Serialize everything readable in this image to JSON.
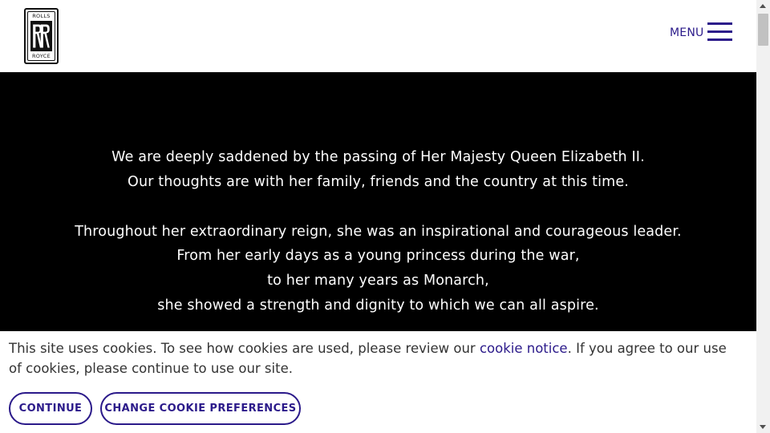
{
  "header": {
    "logo": {
      "top_text": "ROLLS",
      "monogram": "RR",
      "bottom_text": "ROYCE"
    },
    "menu_label": "MENU"
  },
  "tribute": {
    "lines": [
      "We are deeply saddened by the passing of Her Majesty Queen Elizabeth II.",
      "Our thoughts are with her family, friends and the country at this time.",
      "Throughout her extraordinary reign, she was an inspirational and courageous leader.",
      "From her early days as a young princess during the war,",
      "to her many years as Monarch,",
      "she showed a strength and dignity to which we can all aspire."
    ]
  },
  "cookie_banner": {
    "text_before_link": "This site uses cookies. To see how cookies are used, please review our ",
    "link_text": "cookie notice",
    "text_after_link": ". If you agree to our use of cookies, please continue to use our site.",
    "continue_label": "CONTINUE",
    "preferences_label": "CHANGE COOKIE PREFERENCES"
  },
  "colors": {
    "accent": "#2b1a8a",
    "tribute_background": "#000000",
    "page_background": "#ffffff"
  },
  "icons": {
    "menu": "hamburger-icon",
    "scroll_up": "arrow-up-icon",
    "scroll_down": "arrow-down-icon"
  }
}
